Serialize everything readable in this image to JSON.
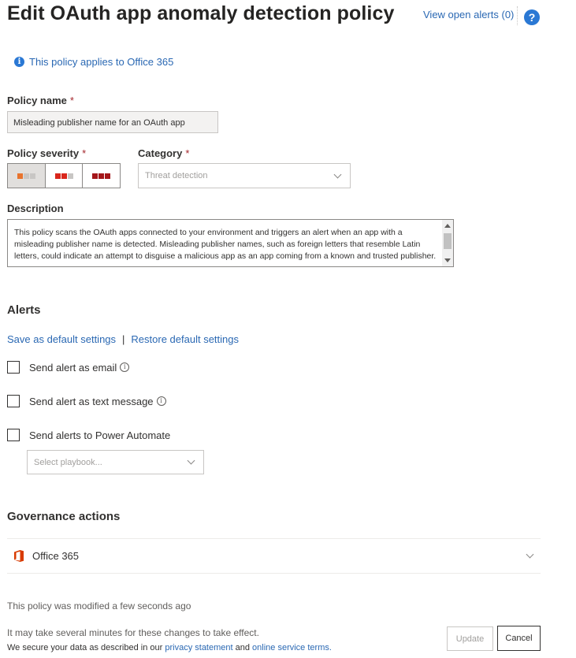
{
  "header": {
    "title": "Edit OAuth app anomaly detection policy",
    "view_alerts": "View open alerts (0)",
    "help_glyph": "?"
  },
  "info": {
    "icon": "info-icon",
    "text": "This policy applies to Office 365"
  },
  "policy_name": {
    "label": "Policy name",
    "required": "*",
    "value": "Misleading publisher name for an OAuth app"
  },
  "severity": {
    "label": "Policy severity",
    "required": "*",
    "selected": "low",
    "options": [
      {
        "name": "low",
        "colors": [
          "#e8742e",
          "#c8c6c4",
          "#c8c6c4"
        ]
      },
      {
        "name": "medium",
        "colors": [
          "#d9261c",
          "#d9261c",
          "#c8c6c4"
        ]
      },
      {
        "name": "high",
        "colors": [
          "#a4161a",
          "#a4161a",
          "#a4161a"
        ]
      }
    ]
  },
  "category": {
    "label": "Category",
    "required": "*",
    "placeholder": "Threat detection"
  },
  "description": {
    "label": "Description",
    "text": "This policy scans the OAuth apps connected to your environment and triggers an alert when an app with a misleading publisher name is detected. Misleading publisher names, such as foreign letters that resemble Latin letters, could indicate an attempt to disguise a malicious app as an app coming from a known and trusted publisher."
  },
  "alerts": {
    "heading": "Alerts",
    "save_default": "Save as default settings",
    "separator": "|",
    "restore_default": "Restore default settings",
    "send_email": "Send alert as email",
    "send_text": "Send alert as text message",
    "send_power_automate": "Send alerts to Power Automate",
    "playbook_placeholder": "Select playbook...",
    "info_glyph": "i"
  },
  "governance": {
    "heading": "Governance actions",
    "office365": "Office 365"
  },
  "footer": {
    "modified": "This policy was modified a few seconds ago",
    "delay_note": "It may take several minutes for these changes to take effect.",
    "secure_prefix": "We secure your data as described in our",
    "privacy_link": "privacy statement",
    "and": "and",
    "terms_link": "online service terms",
    "period": ".",
    "update_button": "Update",
    "cancel_button": "Cancel"
  },
  "colors": {
    "link": "#2a68b3",
    "accent": "#2a78d4",
    "office_red": "#d83b01"
  }
}
